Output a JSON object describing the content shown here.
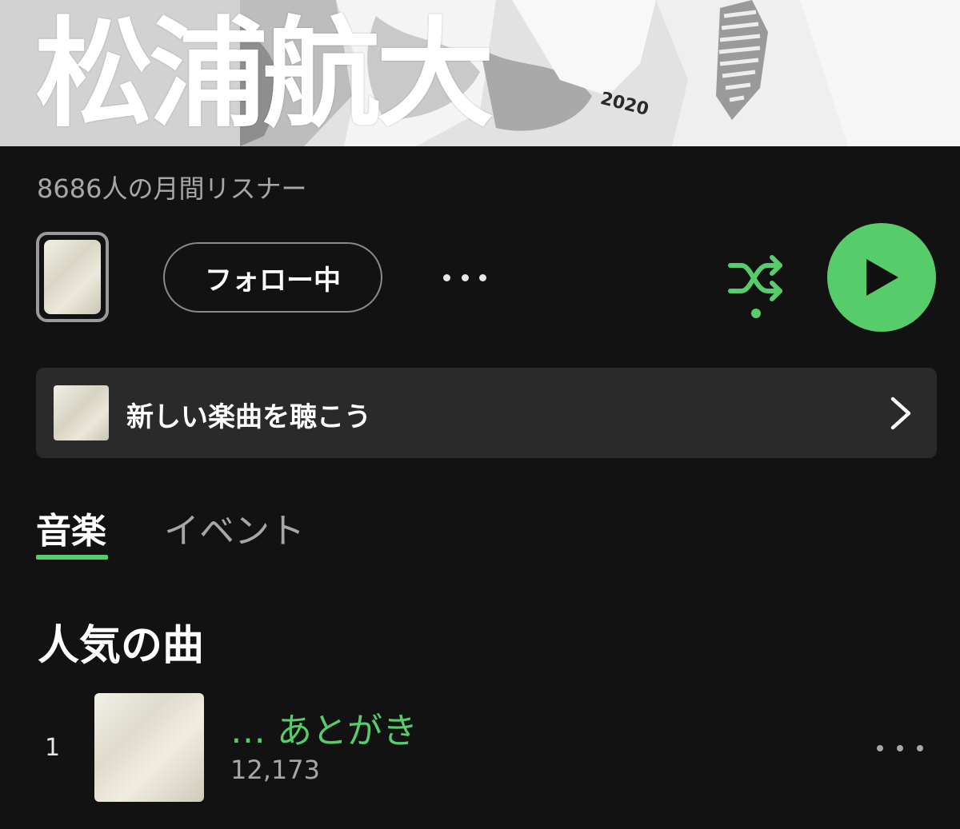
{
  "artist": {
    "name": "松浦航大",
    "hero_text": "2020",
    "monthly_listeners": "8686人の月間リスナー"
  },
  "actions": {
    "follow_label": "フォロー中",
    "more_icon": "more-horizontal-icon",
    "shuffle_icon": "shuffle-icon",
    "play_icon": "play-icon"
  },
  "banner": {
    "text": "新しい楽曲を聴こう",
    "chevron_icon": "chevron-right-icon"
  },
  "tabs": [
    {
      "label": "音楽",
      "active": true
    },
    {
      "label": "イベント",
      "active": false
    }
  ],
  "popular": {
    "title": "人気の曲",
    "tracks": [
      {
        "rank": "1",
        "title": "… あとがき",
        "plays": "12,173"
      }
    ]
  },
  "colors": {
    "accent": "#57cc6b",
    "background": "#121212",
    "card": "#2a2a2a",
    "secondary_text": "#a7a7a7"
  }
}
